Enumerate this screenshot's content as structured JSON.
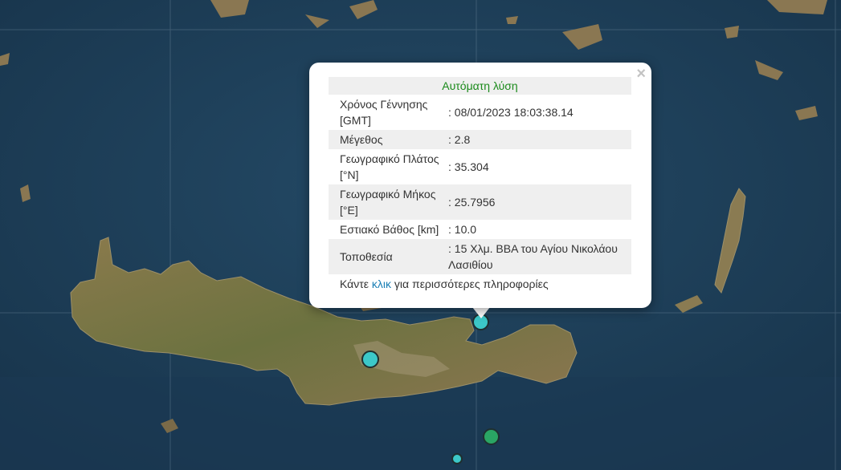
{
  "popup": {
    "header": "Αυτόματη λύση",
    "close_symbol": "×",
    "rows": [
      {
        "label": "Χρόνος Γέννησης [GMT]",
        "value": ": 08/01/2023 18:03:38.14"
      },
      {
        "label": "Μέγεθος",
        "value": ": 2.8"
      },
      {
        "label": "Γεωγραφικό Πλάτος [°N]",
        "value": ": 35.304"
      },
      {
        "label": "Γεωγραφικό Μήκος [°E]",
        "value": ": 25.7956"
      },
      {
        "label": "Εστιακό Βάθος [km]",
        "value": ": 10.0"
      },
      {
        "label": "Τοποθεσία",
        "value": ": 15 Χλμ. ΒΒΑ του Αγίου Νικολάου Λασιθίου"
      }
    ],
    "more_prefix": "Κάντε ",
    "more_link": "κλικ",
    "more_suffix": " για περισσότερες πληροφορίες"
  },
  "markers": [
    {
      "name": "selected-quake-marker",
      "color": "#3cc8c8"
    },
    {
      "name": "quake-marker-central-crete",
      "color": "#3cc8c8"
    },
    {
      "name": "quake-marker-south-green",
      "color": "#2aa564"
    },
    {
      "name": "quake-marker-south-small",
      "color": "#3cc8c8"
    }
  ],
  "colors": {
    "sea": "#1e3d55",
    "land": "#7a7148",
    "header_green": "#1a8a1a",
    "link": "#1a7fb5"
  }
}
